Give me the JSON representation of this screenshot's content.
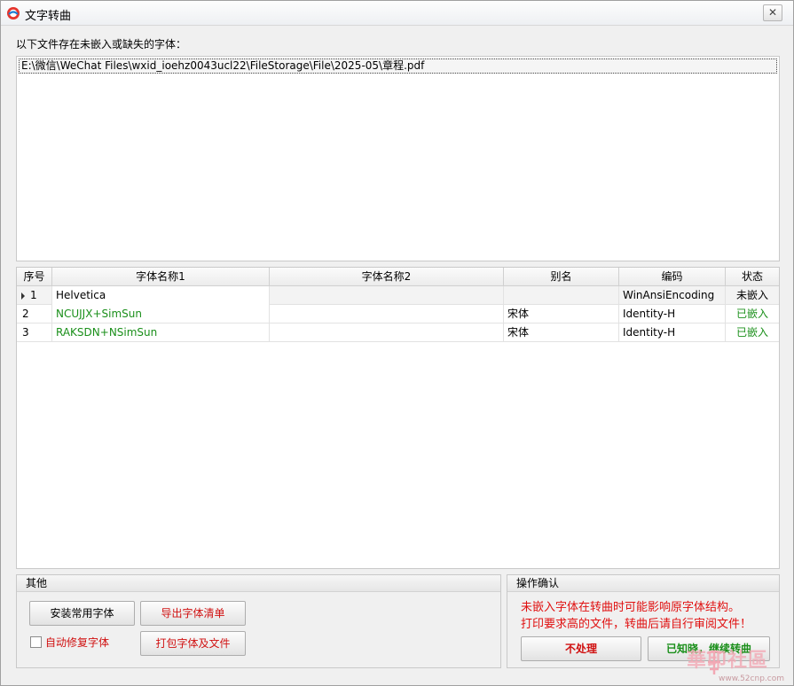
{
  "window": {
    "title": "文字转曲"
  },
  "file_section": {
    "label": "以下文件存在未嵌入或缺失的字体：",
    "files": [
      "E:\\微信\\WeChat Files\\wxid_ioehz0043ucl22\\FileStorage\\File\\2025-05\\章程.pdf"
    ]
  },
  "grid": {
    "columns": [
      "序号",
      "字体名称1",
      "字体名称2",
      "别名",
      "编码",
      "状态"
    ],
    "rows": [
      {
        "index": "1",
        "font1": "Helvetica",
        "font2": "",
        "alias": "",
        "encoding": "WinAnsiEncoding",
        "status": "未嵌入"
      },
      {
        "index": "2",
        "font1": "NCUJJX+SimSun",
        "font2": "",
        "alias": "宋体",
        "encoding": "Identity-H",
        "status": "已嵌入"
      },
      {
        "index": "3",
        "font1": "RAKSDN+NSimSun",
        "font2": "",
        "alias": "宋体",
        "encoding": "Identity-H",
        "status": "已嵌入"
      }
    ]
  },
  "other": {
    "title": "其他",
    "install_fonts": "安装常用字体",
    "export_list": "导出字体清单",
    "auto_fix": "自动修复字体",
    "pack": "打包字体及文件"
  },
  "confirm": {
    "title": "操作确认",
    "warning_line1": "未嵌入字体在转曲时可能影响原字体结构。",
    "warning_line2": "打印要求高的文件，转曲后请自行审阅文件！",
    "skip": "不处理",
    "continue": "已知晓，继续转曲"
  },
  "watermark": {
    "text": "華印社區",
    "url": "www.52cnp.com"
  },
  "colors": {
    "embedded": "#1a8f1a",
    "warning": "#e01010",
    "accent_red": "#d01010"
  },
  "icons": {
    "app": "app-logo-icon",
    "close": "close-icon",
    "row_pointer": "row-pointer-icon"
  }
}
